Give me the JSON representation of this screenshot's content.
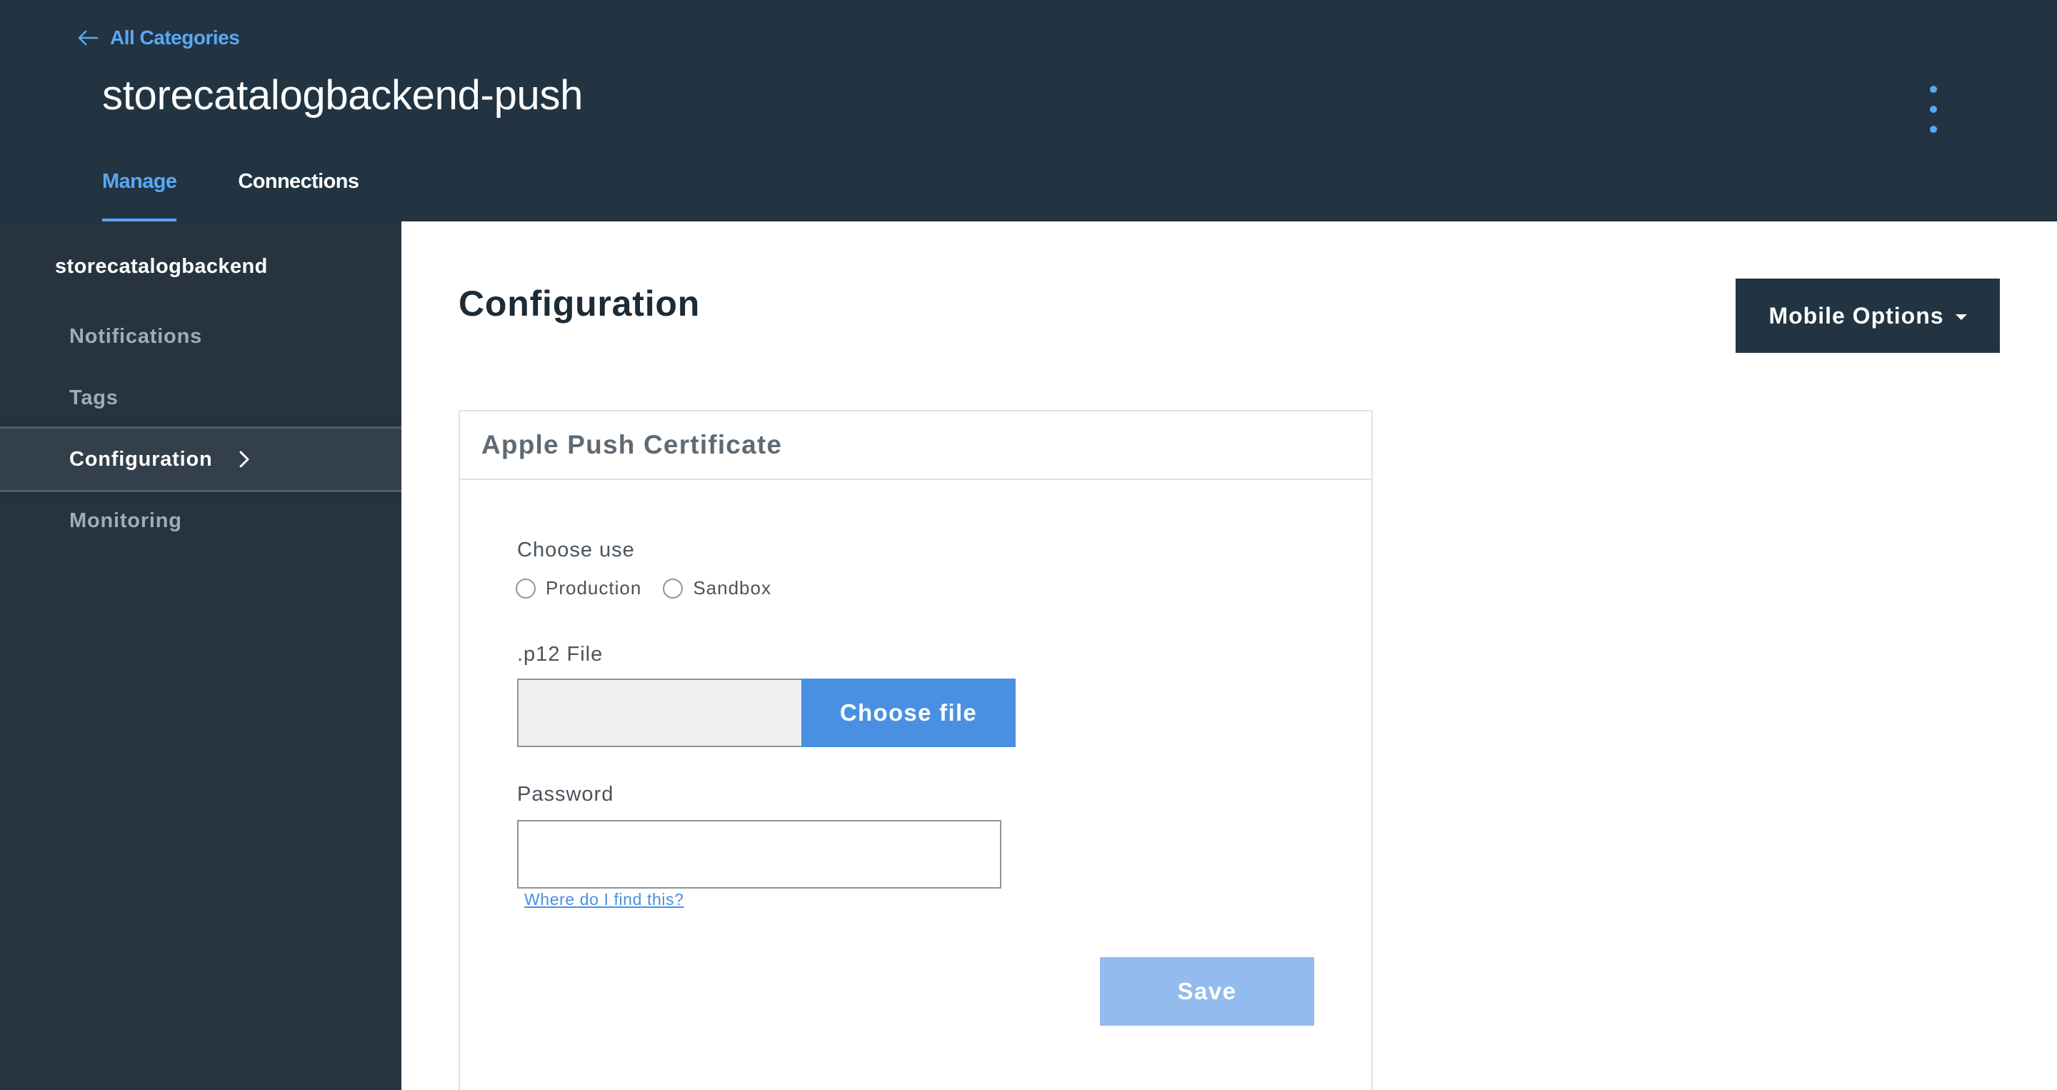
{
  "header": {
    "back_link": "All Categories",
    "title": "storecatalogbackend-push",
    "tabs": [
      {
        "label": "Manage",
        "active": true
      },
      {
        "label": "Connections",
        "active": false
      }
    ]
  },
  "sidebar": {
    "title": "storecatalogbackend",
    "items": [
      {
        "label": "Notifications",
        "active": false
      },
      {
        "label": "Tags",
        "active": false
      },
      {
        "label": "Configuration",
        "active": true
      },
      {
        "label": "Monitoring",
        "active": false
      }
    ]
  },
  "main": {
    "page_title": "Configuration",
    "mobile_options_label": "Mobile Options",
    "card": {
      "title": "Apple Push Certificate",
      "choose_use_label": "Choose use",
      "radio_options": [
        "Production",
        "Sandbox"
      ],
      "file_label": ".p12 File",
      "file_value": "",
      "choose_file_label": "Choose file",
      "password_label": "Password",
      "password_value": "",
      "help_link": "Where do I find this?",
      "save_label": "Save"
    }
  },
  "colors": {
    "header_bg": "#223441",
    "sidebar_bg": "#273440",
    "accent": "#4a90e2",
    "link": "#5aa8f5",
    "save_disabled": "#94bbee"
  },
  "icons": [
    "arrow-left-icon",
    "kebab-menu-icon",
    "chevron-right-icon",
    "caret-down-icon"
  ]
}
